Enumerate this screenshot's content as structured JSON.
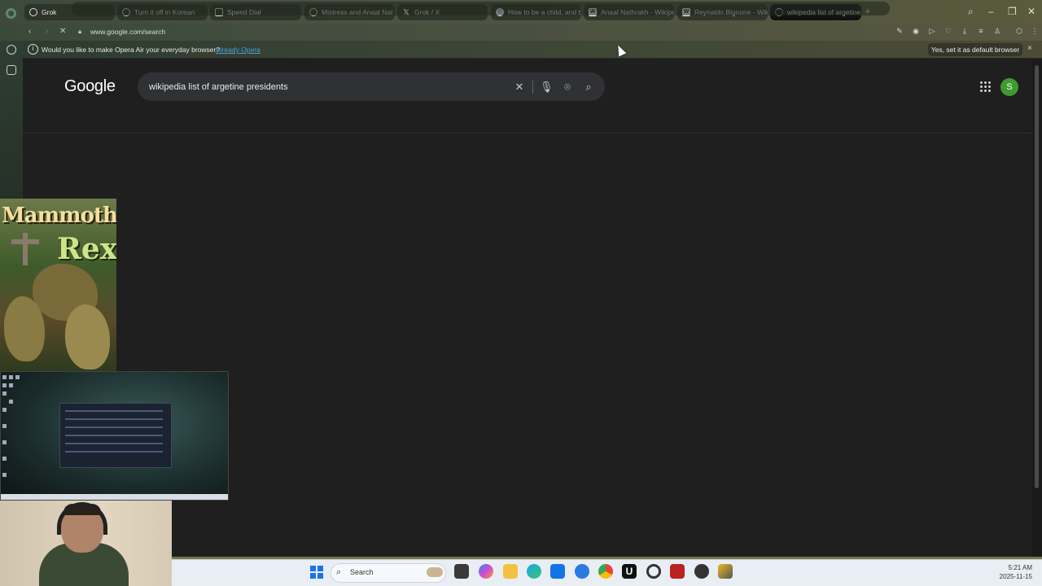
{
  "browser": {
    "tabs": [
      {
        "label": "Grok",
        "icon": "grok-icon",
        "active": false
      },
      {
        "label": "Turn it off in Korean",
        "icon": "grok-icon",
        "active": false
      },
      {
        "label": "Speed Dial",
        "icon": "speed-dial-icon",
        "active": false
      },
      {
        "label": "Mistress and Anaal Nat",
        "icon": "grok-icon",
        "active": false
      },
      {
        "label": "Grok / X",
        "icon": "x-icon",
        "active": false
      },
      {
        "label": "How to be a child, and b",
        "icon": "google-icon",
        "active": false
      },
      {
        "label": "Anaal Nathrakh - Wikipe",
        "icon": "wikipedia-icon",
        "active": false
      },
      {
        "label": "Reynaldo Bignone - Wik",
        "icon": "wikipedia-icon",
        "active": false
      },
      {
        "label": "wikipedia list of argetine",
        "icon": "loading-spinner-icon",
        "active": true
      }
    ],
    "new_tab": "+",
    "url": "www.google.com/search",
    "infobar": {
      "message": "Would you like to make Opera Air your everyday browser?",
      "link": "Already Opera",
      "button": "Yes, set it as default browser",
      "close": "×"
    }
  },
  "page": {
    "logo": "Google",
    "search_query": "wikipedia list of argetine presidents",
    "avatar_letter": "S"
  },
  "overlays": {
    "poster_title_line1": "Mammoth",
    "poster_title_line2": "Rex"
  },
  "taskbar": {
    "search_label": "Search",
    "time": "5:21 AM",
    "date": "2025-11-15"
  },
  "colors": {
    "page_bg": "#1f1f1f",
    "search_box": "#303134",
    "avatar": "#3f9a2f",
    "link": "#4aa0e0"
  }
}
